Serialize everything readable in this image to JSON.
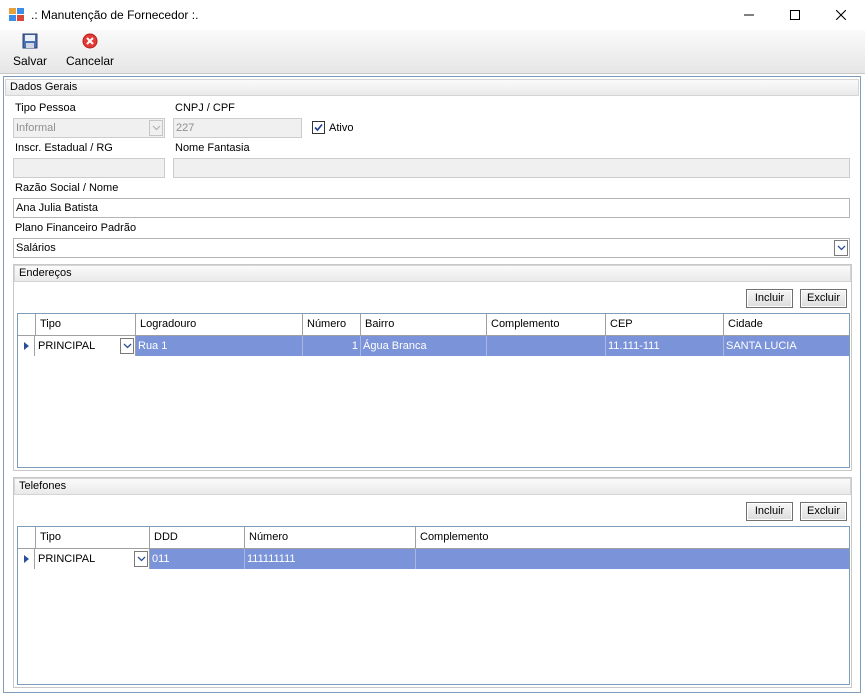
{
  "window": {
    "title": ".: Manutenção de Fornecedor :."
  },
  "toolbar": {
    "save_label": "Salvar",
    "cancel_label": "Cancelar"
  },
  "dados_gerais": {
    "header": "Dados Gerais",
    "tipo_pessoa_label": "Tipo Pessoa",
    "tipo_pessoa_value": "Informal",
    "cnpj_label": "CNPJ / CPF",
    "cnpj_value": "227",
    "ativo_label": "Ativo",
    "ativo_checked": true,
    "inscr_label": "Inscr. Estadual / RG",
    "inscr_value": "",
    "fantasia_label": "Nome Fantasia",
    "fantasia_value": "",
    "razao_label": "Razão Social / Nome",
    "razao_value": "Ana Julia Batista",
    "plano_label": "Plano Financeiro Padrão",
    "plano_value": "Salários"
  },
  "enderecos": {
    "header": "Endereços",
    "include_label": "Incluir",
    "delete_label": "Excluir",
    "columns": [
      "Tipo",
      "Logradouro",
      "Número",
      "Bairro",
      "Complemento",
      "CEP",
      "Cidade"
    ],
    "rows": [
      [
        "PRINCIPAL",
        "Rua 1",
        "1",
        "Água Branca",
        "",
        "11.111-111",
        "SANTA LUCIA"
      ]
    ]
  },
  "telefones": {
    "header": "Telefones",
    "include_label": "Incluir",
    "delete_label": "Excluir",
    "columns": [
      "Tipo",
      "DDD",
      "Número",
      "Complemento"
    ],
    "rows": [
      [
        "PRINCIPAL",
        "011",
        "111111111",
        ""
      ]
    ]
  },
  "colors": {
    "selection": "#7b93d8",
    "border_accent": "#7f9db9",
    "cancel_red": "#e53935"
  }
}
